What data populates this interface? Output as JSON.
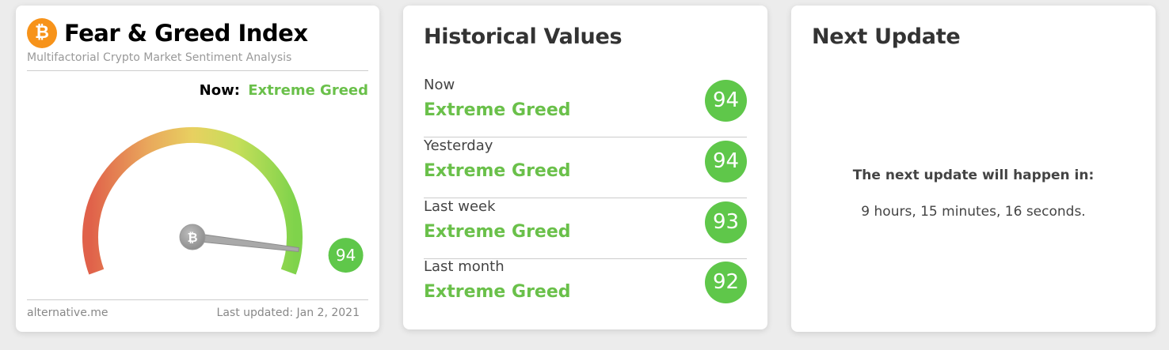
{
  "fear_greed": {
    "title": "Fear & Greed Index",
    "subtitle": "Multifactorial Crypto Market Sentiment Analysis",
    "logo_symbol": "₿",
    "now_label": "Now:",
    "now_value": "Extreme Greed",
    "value": 94,
    "gauge_min": 0,
    "gauge_max": 100,
    "needle_symbol": "₿",
    "footer_source": "alternative.me",
    "footer_updated": "Last updated: Jan 2, 2021",
    "colors": {
      "accent": "#6ac04a",
      "brand": "#f7931a",
      "badge": "#5fc74a"
    }
  },
  "historical": {
    "title": "Historical Values",
    "rows": [
      {
        "label": "Now",
        "classification": "Extreme Greed",
        "value": "94"
      },
      {
        "label": "Yesterday",
        "classification": "Extreme Greed",
        "value": "94"
      },
      {
        "label": "Last week",
        "classification": "Extreme Greed",
        "value": "93"
      },
      {
        "label": "Last month",
        "classification": "Extreme Greed",
        "value": "92"
      }
    ]
  },
  "next_update": {
    "title": "Next Update",
    "question": "The next update will happen in:",
    "countdown": "9 hours, 15 minutes, 16 seconds."
  }
}
